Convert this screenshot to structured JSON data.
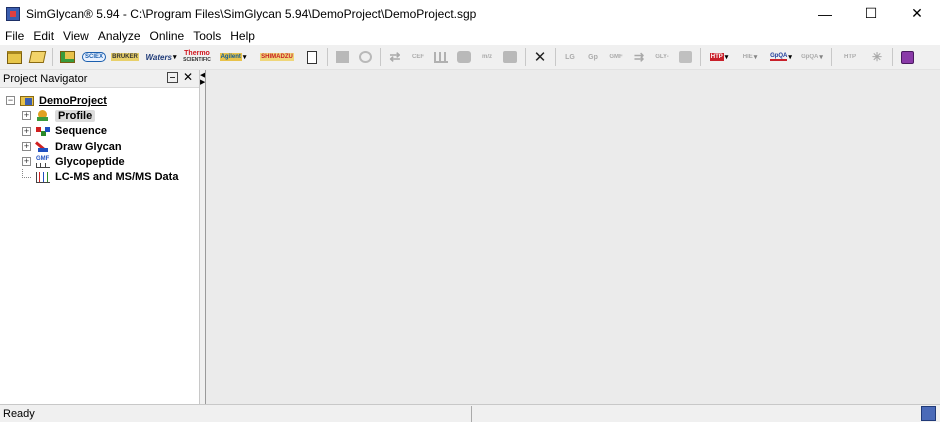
{
  "window": {
    "title": "SimGlycan® 5.94 - C:\\Program Files\\SimGlycan 5.94\\DemoProject\\DemoProject.sgp",
    "controls": {
      "minimize": "—",
      "maximize": "☐",
      "close": "✕"
    }
  },
  "menu": [
    "File",
    "Edit",
    "View",
    "Analyze",
    "Online",
    "Tools",
    "Help"
  ],
  "toolbar": {
    "brand_labels": {
      "sciex": "SCIEX",
      "bruker": "BRUKER",
      "waters": "Waters",
      "thermo_top": "Thermo",
      "thermo_bottom": "SCIENTIFIC",
      "agilent": "Agilent",
      "shimadzu": "SHIMADZU"
    },
    "small_labels": {
      "cef": "CEF",
      "mz": "m/z",
      "lg": "LG",
      "gp": "Gp",
      "gmf": "GMF",
      "gly": "GLY-",
      "htp": "HTP",
      "hie": "HIE",
      "gpqa": "GpQA",
      "htp_gpqa": "HTP"
    },
    "colors": {
      "thermo": "#d0161e",
      "waters": "#1e3a78",
      "sciex": "#1b5fae",
      "shimadzu": "#c81e24"
    }
  },
  "navigator": {
    "title": "Project Navigator",
    "close_label": "✕",
    "root": "DemoProject",
    "items": [
      {
        "label": "Profile",
        "icon": "profile-icon",
        "expander": "+"
      },
      {
        "label": "Sequence",
        "icon": "sequence-icon",
        "expander": "+"
      },
      {
        "label": "Draw Glycan",
        "icon": "draw-glycan-icon",
        "expander": "+"
      },
      {
        "label": "Glycopeptide",
        "icon": "glycopeptide-icon",
        "expander": "+"
      },
      {
        "label": "LC-MS and MS/MS Data",
        "icon": "lcms-data-icon",
        "expander": ""
      }
    ],
    "root_expander": "−"
  },
  "status": {
    "text": "Ready",
    "right": ""
  }
}
